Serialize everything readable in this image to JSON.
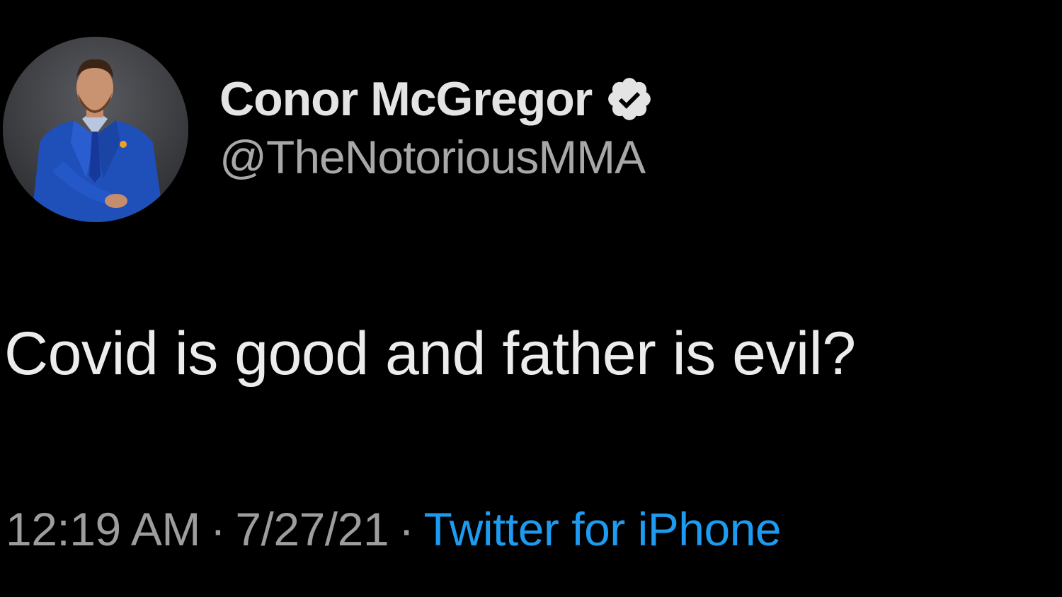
{
  "tweet": {
    "author": {
      "display_name": "Conor McGregor",
      "handle": "@TheNotoriousMMA",
      "verified": true,
      "avatar_icon": "profile-photo"
    },
    "text": "Covid is good and father is evil?",
    "meta": {
      "time": "12:19 AM",
      "separator": "·",
      "date": "7/27/21",
      "source": "Twitter for iPhone"
    }
  },
  "colors": {
    "background": "#000000",
    "primary_text": "#e4e4e4",
    "secondary_text": "#9d9d9d",
    "link": "#1d9bf0"
  }
}
